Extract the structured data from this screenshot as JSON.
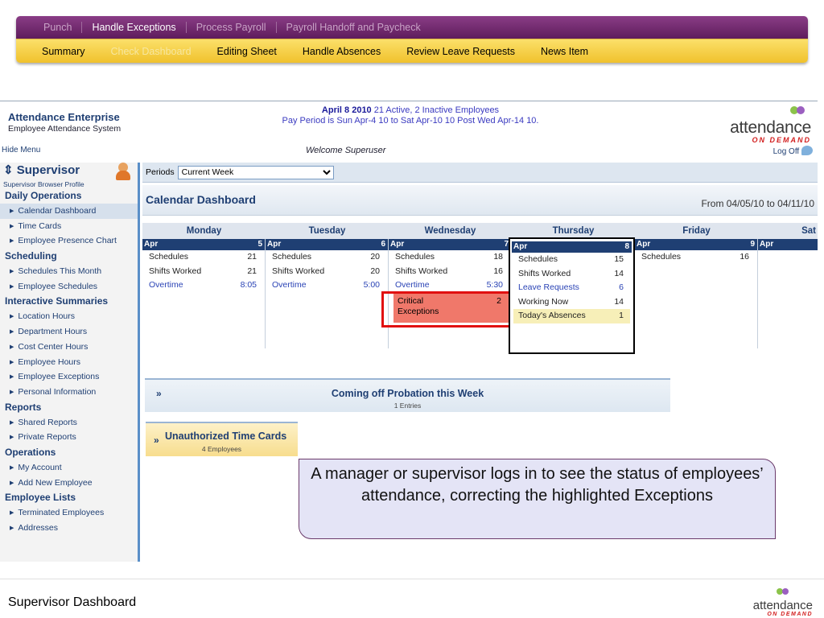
{
  "topnav": {
    "row1": [
      {
        "label": "Punch",
        "active": false
      },
      {
        "label": "Handle Exceptions",
        "active": true
      },
      {
        "label": "Process Payroll",
        "active": false
      },
      {
        "label": "Payroll Handoff and Paycheck",
        "active": false
      }
    ],
    "row2": [
      {
        "label": "Summary",
        "active": false
      },
      {
        "label": "Check Dashboard",
        "active": true
      },
      {
        "label": "Editing Sheet",
        "active": false
      },
      {
        "label": "Handle Absences",
        "active": false
      },
      {
        "label": "Review Leave Requests",
        "active": false
      },
      {
        "label": "News Item",
        "active": false
      }
    ]
  },
  "header": {
    "app_title": "Attendance Enterprise",
    "app_subtitle": "Employee Attendance System",
    "date": "April 8 2010",
    "employees": "21 Active, 2 Inactive Employees",
    "pay_period": "Pay Period is Sun Apr-4 10 to Sat Apr-10 10 Post Wed Apr-14 10.",
    "hide_menu": "Hide Menu",
    "welcome": "Welcome Superuser",
    "log_off": "Log Off",
    "logo_word": "attendance",
    "logo_sub": "ON DEMAND"
  },
  "sidebar": {
    "title": "Supervisor",
    "profile": "Supervisor Browser Profile",
    "sections": [
      {
        "label": "Daily Operations",
        "items": [
          "Calendar Dashboard",
          "Time Cards",
          "Employee Presence Chart"
        ]
      },
      {
        "label": "Scheduling",
        "items": [
          "Schedules This Month",
          "Employee Schedules"
        ]
      },
      {
        "label": "Interactive Summaries",
        "items": [
          "Location Hours",
          "Department Hours",
          "Cost Center Hours",
          "Employee Hours",
          "Employee Exceptions",
          "Personal Information"
        ]
      },
      {
        "label": "Reports",
        "items": [
          "Shared Reports",
          "Private Reports"
        ]
      },
      {
        "label": "Operations",
        "items": [
          "My Account",
          "Add New Employee"
        ]
      },
      {
        "label": "Employee Lists",
        "items": [
          "Terminated Employees",
          "Addresses"
        ]
      }
    ],
    "active_item": "Calendar Dashboard"
  },
  "periods": {
    "label": "Periods",
    "selected": "Current Week"
  },
  "dashboard": {
    "title": "Calendar Dashboard",
    "range": "From 04/05/10 to 04/11/10"
  },
  "calendar": {
    "month": "Apr",
    "days": [
      {
        "name": "Monday",
        "date": "5",
        "rows": [
          {
            "label": "Schedules",
            "value": "21"
          },
          {
            "label": "Shifts Worked",
            "value": "21"
          },
          {
            "label": "Overtime",
            "value": "8:05",
            "link": true
          }
        ]
      },
      {
        "name": "Tuesday",
        "date": "6",
        "rows": [
          {
            "label": "Schedules",
            "value": "20"
          },
          {
            "label": "Shifts Worked",
            "value": "20"
          },
          {
            "label": "Overtime",
            "value": "5:00",
            "link": true
          }
        ]
      },
      {
        "name": "Wednesday",
        "date": "7",
        "rows": [
          {
            "label": "Schedules",
            "value": "18"
          },
          {
            "label": "Shifts Worked",
            "value": "16"
          },
          {
            "label": "Overtime",
            "value": "5:30",
            "link": true
          }
        ]
      },
      {
        "name": "Thursday",
        "date": "8",
        "rows": [
          {
            "label": "Schedules",
            "value": "15"
          },
          {
            "label": "Shifts Worked",
            "value": "14"
          },
          {
            "label": "Leave Requests",
            "value": "6",
            "link": true
          },
          {
            "label": "Working Now",
            "value": "14"
          },
          {
            "label": "Today's Absences",
            "value": "1",
            "highlight": true
          }
        ]
      },
      {
        "name": "Friday",
        "date": "9",
        "rows": [
          {
            "label": "Schedules",
            "value": "16"
          }
        ]
      },
      {
        "name": "Sat",
        "date": "",
        "rows": []
      }
    ],
    "critical": {
      "label_line1": "Critical",
      "label_line2": "Exceptions",
      "value": "2"
    }
  },
  "probation": {
    "title": "Coming off Probation this Week",
    "count": "1 Entries"
  },
  "unauthorized": {
    "title": "Unauthorized Time Cards",
    "count": "4 Employees"
  },
  "callout": {
    "text": "A manager or supervisor logs in to see the status of employees’ attendance, correcting the highlighted Exceptions"
  },
  "footer": {
    "title": "Supervisor Dashboard",
    "logo_word": "attendance",
    "logo_sub": "ON DEMAND"
  },
  "colors": {
    "nav_purple": "#5e1c5c",
    "nav_yellow": "#f0c12c",
    "brand_blue": "#1f3f73",
    "critical_red": "#f0786a",
    "highlight_border": "#e11010"
  }
}
